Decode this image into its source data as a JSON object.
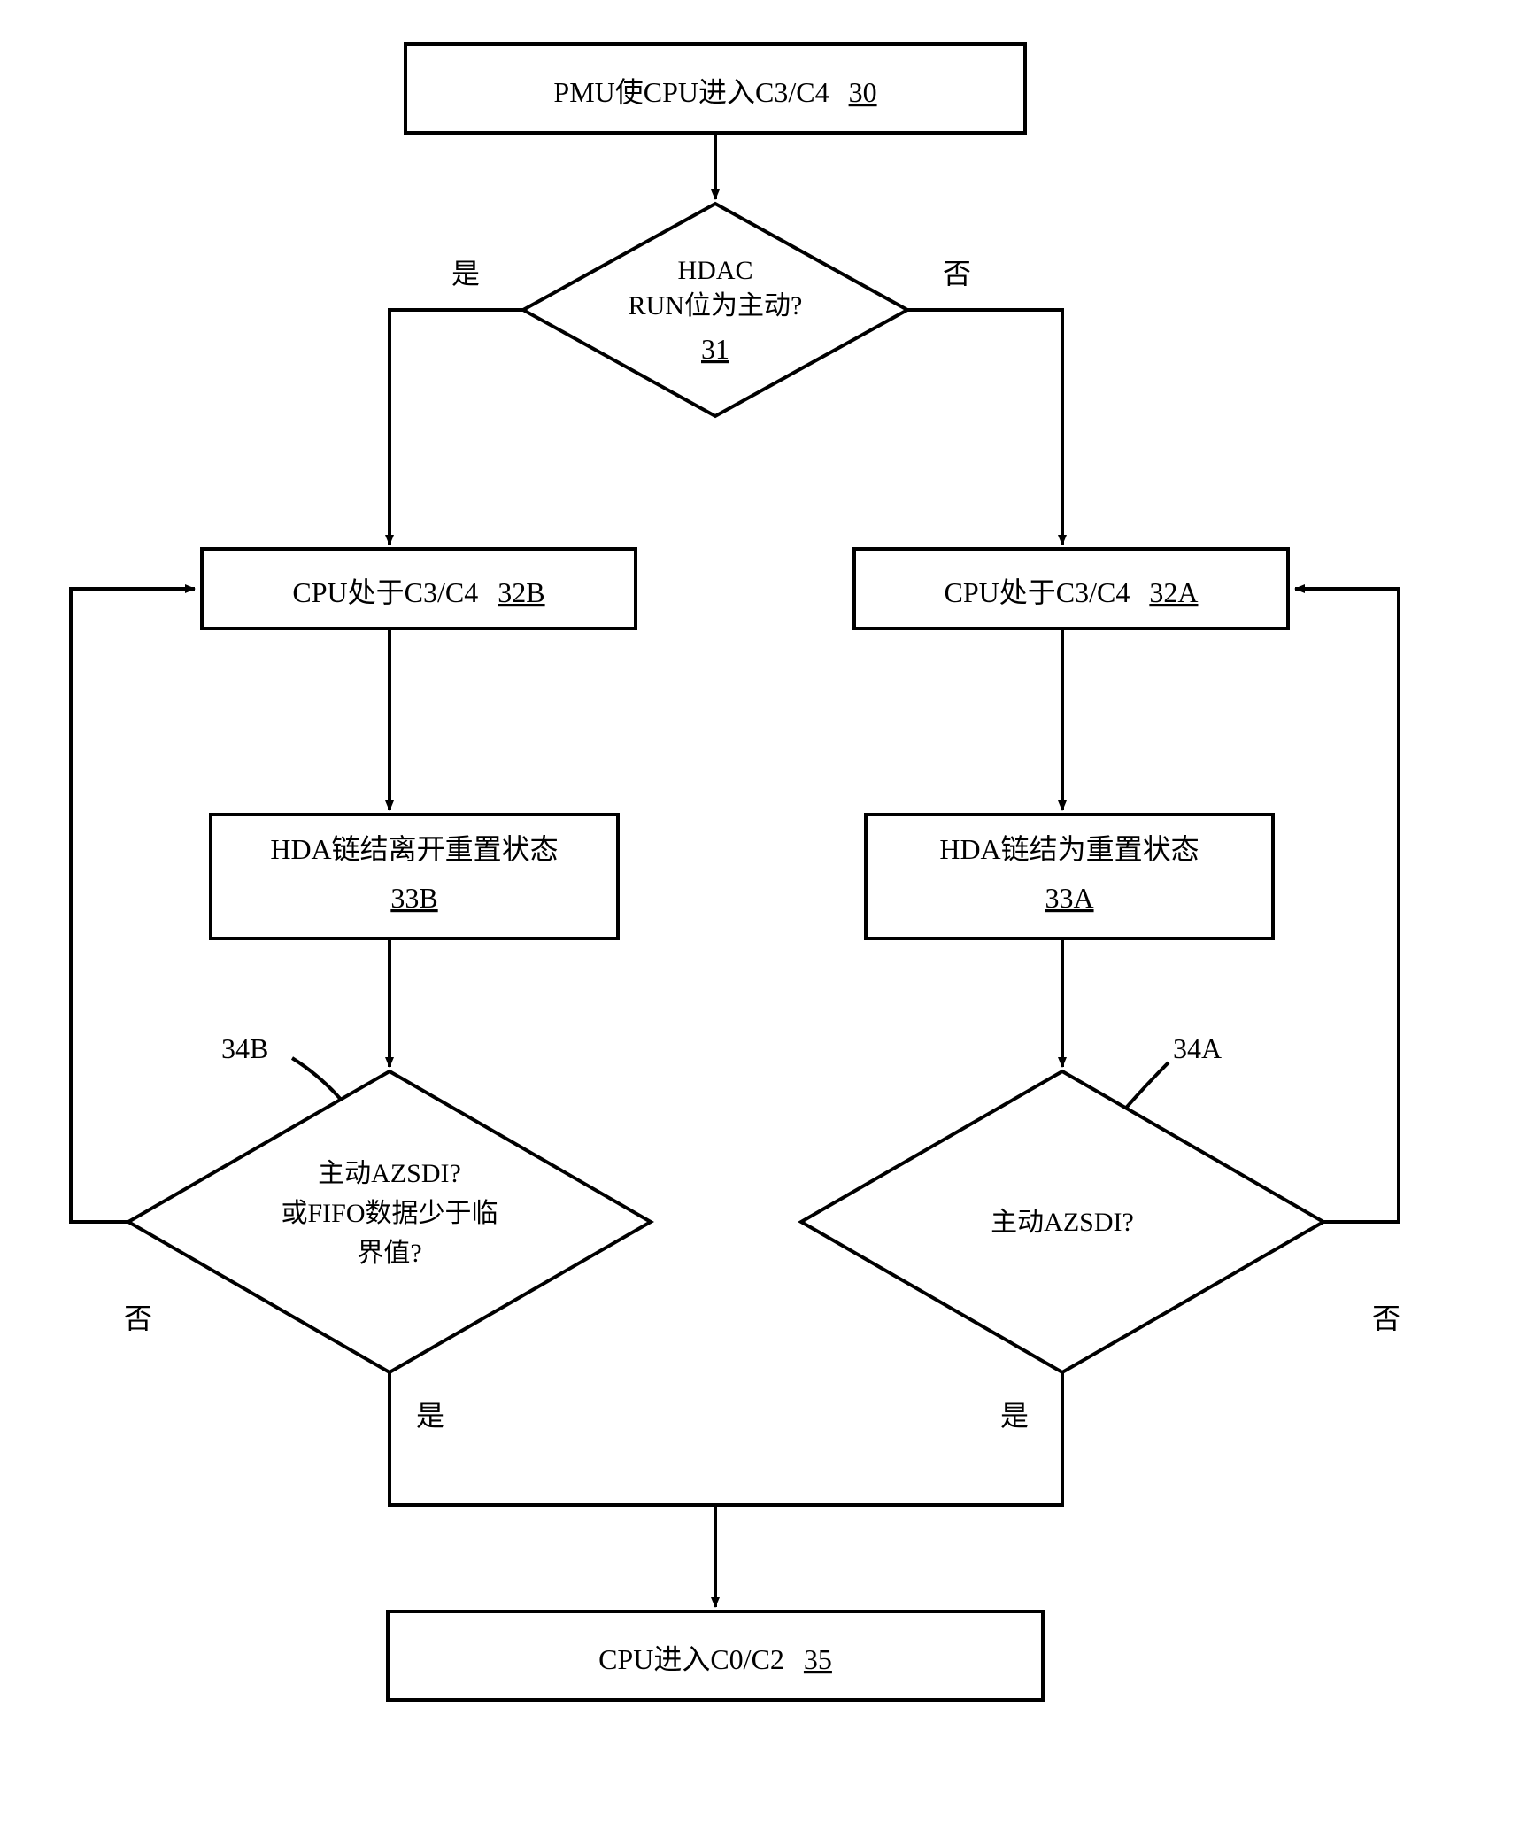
{
  "nodes": {
    "n30": {
      "text": "PMU使CPU进入C3/C4",
      "ref": "30"
    },
    "n31": {
      "line1": "HDAC",
      "line2": "RUN位为主动?",
      "ref": "31"
    },
    "n32b": {
      "text": "CPU处于C3/C4",
      "ref": "32B"
    },
    "n32a": {
      "text": "CPU处于C3/C4",
      "ref": "32A"
    },
    "n33b": {
      "text": "HDA链结离开重置状态",
      "ref": "33B"
    },
    "n33a": {
      "text": "HDA链结为重置状态",
      "ref": "33A"
    },
    "n34b": {
      "line1": "主动AZSDI?",
      "line2": "或FIFO数据少于临",
      "line3": "界值?",
      "ref": "34B"
    },
    "n34a": {
      "text": "主动AZSDI?",
      "ref": "34A"
    },
    "n35": {
      "text": "CPU进入C0/C2",
      "ref": "35"
    }
  },
  "labels": {
    "yes": "是",
    "no": "否"
  }
}
